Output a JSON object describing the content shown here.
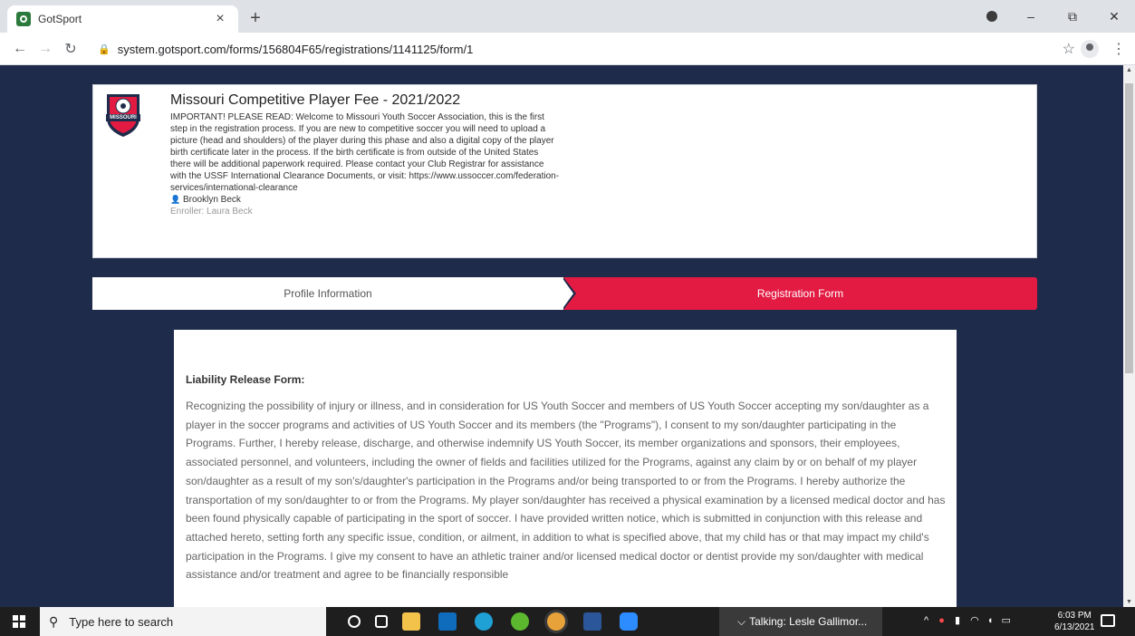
{
  "browser": {
    "tab_title": "GotSport",
    "tab_close": "×",
    "new_tab": "+",
    "url": "system.gotsport.com/forms/156804F65/registrations/1141125/form/1",
    "window_minimize": "–",
    "window_restore": "⧉",
    "window_close": "✕"
  },
  "header": {
    "title": "Missouri Competitive Player Fee - 2021/2022",
    "description": "IMPORTANT! PLEASE READ: Welcome to Missouri Youth Soccer Association, this is the first step in the registration process. If you are new to competitive soccer you will need to upload a picture (head and shoulders) of the player during this phase and also a digital copy of the player birth certificate later in the process. If the birth certificate is from outside of the United States there will be additional paperwork required. Please contact your Club Registrar for assistance with the USSF International Clearance Documents, or visit: https://www.ussoccer.com/federation-services/international-clearance",
    "player_name": "Brooklyn Beck",
    "enroller": "Enroller: Laura Beck",
    "logo_text": "MISSOURI"
  },
  "steps": [
    {
      "label": "Profile Information",
      "active": false
    },
    {
      "label": "Registration Form",
      "active": true
    }
  ],
  "form": {
    "heading": "Liability Release Form:",
    "body": "Recognizing the possibility of injury or illness, and in consideration for US Youth Soccer and members of US Youth Soccer accepting my son/daughter as a player in the soccer programs and activities of US Youth Soccer and its members (the \"Programs\"), I consent to my son/daughter participating in the Programs. Further, I hereby release, discharge, and otherwise indemnify US Youth Soccer, its member organizations and sponsors, their employees, associated personnel, and volunteers, including the owner of fields and facilities utilized for the Programs, against any claim by or on behalf of my player son/daughter as a result of my son's/daughter's participation in the Programs and/or being transported to or from the Programs. I hereby authorize the transportation of my son/daughter to or from the Programs. My player son/daughter has received a physical examination by a licensed medical doctor and has been found physically capable of participating in the sport of soccer. I have provided written notice, which is submitted in conjunction with this release and attached hereto, setting forth any specific issue, condition, or ailment, in addition to what is specified above, that my child has or that may impact my child's participation in the Programs. I give my consent to have an athletic trainer and/or licensed medical doctor or dentist provide my son/daughter with medical assistance and/or treatment and agree to be financially responsible"
  },
  "taskbar": {
    "search_placeholder": "Type here to search",
    "talking": "Talking: Lesle Gallimor...",
    "time": "6:03 PM",
    "date": "6/13/2021"
  },
  "colors": {
    "page_background": "#1f2b4b",
    "active_step": "#e31b43"
  }
}
